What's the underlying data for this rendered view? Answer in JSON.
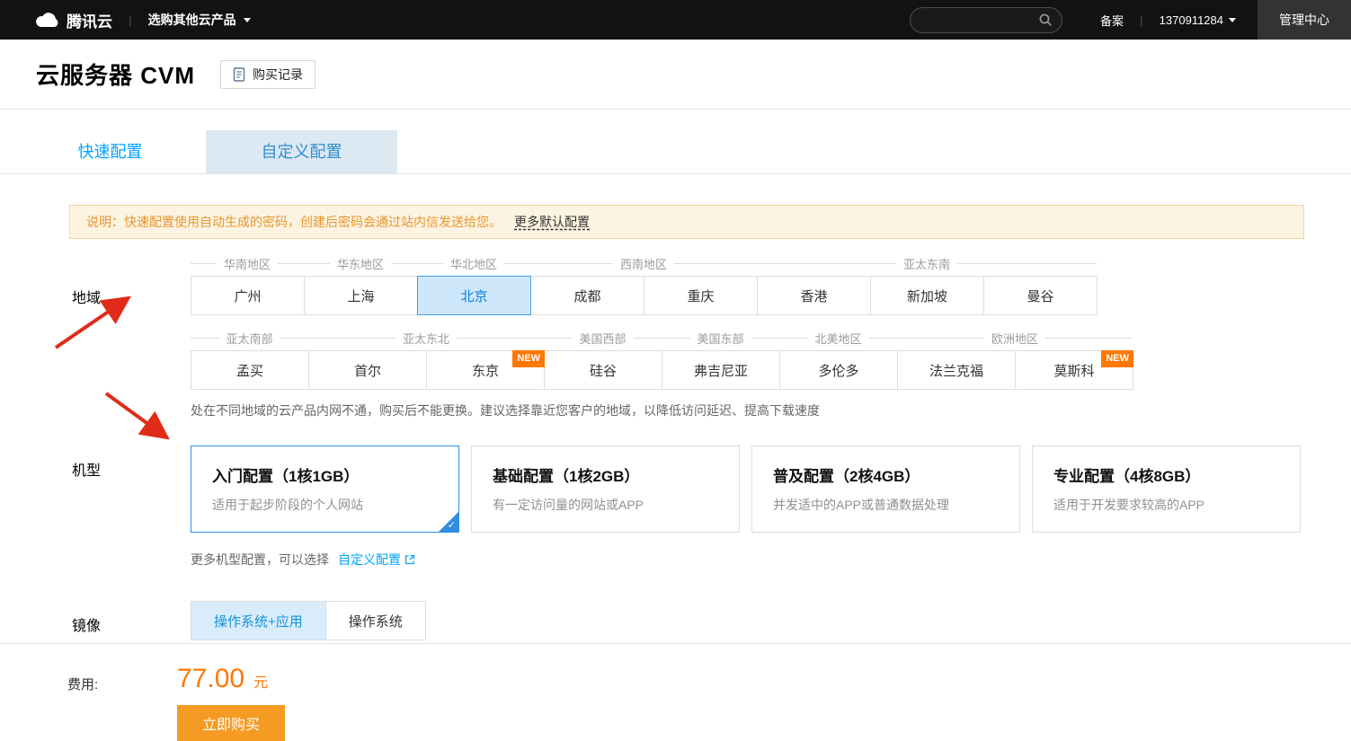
{
  "topbar": {
    "brand": "腾讯云",
    "products_menu": "选购其他云产品",
    "beian": "备案",
    "account_id": "1370911284",
    "console": "管理中心"
  },
  "header": {
    "title": "云服务器 CVM",
    "purchase_history": "购买记录"
  },
  "tabs": {
    "quick": "快速配置",
    "custom": "自定义配置"
  },
  "notice": {
    "text": "说明：快速配置使用自动生成的密码，创建后密码会通过站内信发送给您。",
    "link": "更多默认配置"
  },
  "region": {
    "label": "地域",
    "row1": [
      {
        "name": "华南地区",
        "cities": [
          {
            "name": "广州"
          }
        ]
      },
      {
        "name": "华东地区",
        "cities": [
          {
            "name": "上海"
          }
        ]
      },
      {
        "name": "华北地区",
        "cities": [
          {
            "name": "北京"
          }
        ]
      },
      {
        "name": "西南地区",
        "cities": [
          {
            "name": "成都"
          },
          {
            "name": "重庆"
          }
        ]
      },
      {
        "name": "亚太东南",
        "cities": [
          {
            "name": "香港"
          },
          {
            "name": "新加坡"
          },
          {
            "name": "曼谷"
          }
        ]
      }
    ],
    "row2": [
      {
        "name": "亚太南部",
        "cities": [
          {
            "name": "孟买"
          }
        ]
      },
      {
        "name": "亚太东北",
        "cities": [
          {
            "name": "首尔"
          },
          {
            "name": "东京",
            "badge": "NEW"
          }
        ]
      },
      {
        "name": "美国西部",
        "cities": [
          {
            "name": "硅谷"
          }
        ]
      },
      {
        "name": "美国东部",
        "cities": [
          {
            "name": "弗吉尼亚"
          }
        ]
      },
      {
        "name": "北美地区",
        "cities": [
          {
            "name": "多伦多"
          }
        ]
      },
      {
        "name": "欧洲地区",
        "cities": [
          {
            "name": "法兰克福"
          },
          {
            "name": "莫斯科",
            "badge": "NEW"
          }
        ]
      }
    ],
    "selected_city": "北京",
    "note": "处在不同地域的云产品内网不通，购买后不能更换。建议选择靠近您客户的地域，以降低访问延迟、提高下载速度"
  },
  "instance": {
    "label": "机型",
    "cards": [
      {
        "title": "入门配置（1核1GB）",
        "desc": "适用于起步阶段的个人网站"
      },
      {
        "title": "基础配置（1核2GB）",
        "desc": "有一定访问量的网站或APP"
      },
      {
        "title": "普及配置（2核4GB）",
        "desc": "并发适中的APP或普通数据处理"
      },
      {
        "title": "专业配置（4核8GB）",
        "desc": "适用于开发要求较高的APP"
      }
    ],
    "selected_card": "入门配置（1核1GB）",
    "more_text": "更多机型配置，可以选择",
    "more_link": "自定义配置"
  },
  "image": {
    "label": "镜像",
    "options": [
      {
        "label": "操作系统+应用"
      },
      {
        "label": "操作系统"
      }
    ],
    "selected_option": "操作系统+应用"
  },
  "footer": {
    "fee_label": "费用:",
    "price": "77.00",
    "currency": "元",
    "buy": "立即购买"
  },
  "icons": {
    "check": "✓"
  },
  "colors": {
    "accent_blue": "#00a4ff",
    "selected_fill": "#cfe7fb",
    "badge_orange": "#ff7800",
    "price_orange": "#ff7800",
    "buy_button_orange": "#f59a23",
    "notice_bg": "#fdf3e1",
    "annotation_red": "#df2b18"
  }
}
